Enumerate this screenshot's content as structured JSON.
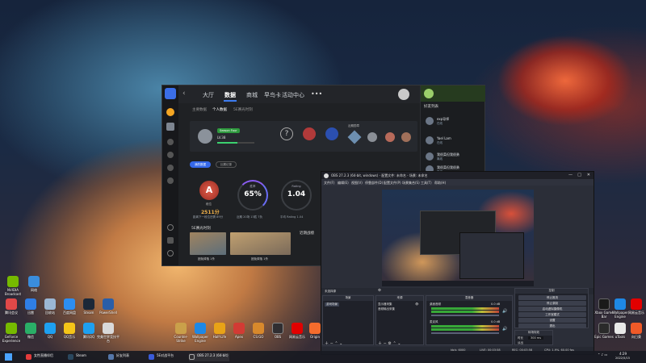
{
  "desktop": {
    "left_icons": [
      {
        "label": "NVIDIA Broadcast",
        "color": "#76b900"
      },
      {
        "label": "网络",
        "color": "#3a8ddc"
      },
      {
        "label": "腾讯会议",
        "color": "#e04848"
      },
      {
        "label": "迅雷",
        "color": "#2f7ee6"
      },
      {
        "label": "回收站",
        "color": "#9bb7d4"
      },
      {
        "label": "百度网盘",
        "color": "#2c8ef2"
      },
      {
        "label": "Steam",
        "color": "#1b2838"
      },
      {
        "label": "PowerShell",
        "color": "#2a5ea8"
      },
      {
        "label": "GeForce Experience",
        "color": "#76b900"
      },
      {
        "label": "微信",
        "color": "#2aae67"
      },
      {
        "label": "QQ",
        "color": "#1ea0f0"
      },
      {
        "label": "QQ音乐",
        "color": "#f5c518"
      },
      {
        "label": "腾讯QQ",
        "color": "#1ea0f0"
      },
      {
        "label": "完美世界竞技平台",
        "color": "#d9d9d9"
      }
    ],
    "dock_icons": [
      {
        "label": "Counter-Strike",
        "color": "#caa04a"
      },
      {
        "label": "Wallpaper Engine",
        "color": "#1e88e5"
      },
      {
        "label": "Half-Life",
        "color": "#e8a317"
      },
      {
        "label": "Apex",
        "color": "#d23b34"
      },
      {
        "label": "CS:GO",
        "color": "#d8892c"
      },
      {
        "label": "OBS",
        "color": "#302e31"
      },
      {
        "label": "网易云音乐",
        "color": "#e20000"
      },
      {
        "label": "Origin",
        "color": "#f56c2d"
      }
    ],
    "right_icons": [
      {
        "label": "Xbox Game Bar",
        "color": "#1a1a1a"
      },
      {
        "label": "Wallpaper Engine",
        "color": "#1e88e5"
      },
      {
        "label": "网易云音乐",
        "color": "#e20000"
      },
      {
        "label": "Epic Games",
        "color": "#2a2a2a"
      },
      {
        "label": "uTools",
        "color": "#e8e8e8"
      },
      {
        "label": "向日葵",
        "color": "#f05a28"
      }
    ]
  },
  "client": {
    "nav_tabs": [
      "大厅",
      "数据",
      "商城",
      "早鸟卡",
      "活动中心"
    ],
    "active_tab": "数据",
    "sub_tabs": [
      "主要数据",
      "个人数据",
      "5E赛光时刻"
    ],
    "profile": {
      "level_badge": "Season Four",
      "rank_text": "LV.38",
      "progress": 0.55
    },
    "medals_title": "近期勋章",
    "rank": {
      "letter": "A",
      "label": "段位",
      "score": "2511分",
      "score_sub": "距离下一段位还需 89分"
    },
    "rings": [
      {
        "label": "胜率",
        "value": "65%",
        "sub": "近期 20场 13胜 7负"
      },
      {
        "label": "Rating",
        "value": "1.04",
        "sub": "平均 Rating 1.04"
      }
    ],
    "highlights_title": "5E赛光时刻",
    "recent_title": "近期战绩",
    "clips": [
      {
        "caption": "团免掉落 1杀"
      },
      {
        "caption": "团免掉落 1杀"
      }
    ],
    "buttons": [
      "我的数据",
      "比赛记录"
    ],
    "friends_title": "好友列表",
    "friends": [
      {
        "name": "exp导师",
        "status": "在线"
      },
      {
        "name": "Yael Lam",
        "status": "在线"
      },
      {
        "name": "我很菜但我很勇",
        "status": "离线"
      },
      {
        "name": "我很菜但我很勇",
        "status": "离线"
      }
    ]
  },
  "obs": {
    "title": "OBS 27.2.3 (64-bit, windows) - 配置文件: 未命名 - 场景: 未命名",
    "menus": [
      "文件(F)",
      "编辑(E)",
      "视图(V)",
      "停靠部件(D)",
      "配置文件(P)",
      "场景集合(S)",
      "工具(T)",
      "帮助(H)"
    ],
    "no_source": "未选择源",
    "panels": {
      "scenes": {
        "title": "场景",
        "items": [
          "游戏场景"
        ]
      },
      "sources": {
        "title": "来源",
        "items": [
          "显示器采集",
          "音频输出采集"
        ]
      },
      "mixer": {
        "title": "混音器",
        "channels": [
          {
            "name": "桌面音频",
            "db": "0.0 dB"
          },
          {
            "name": "麦克风",
            "db": "0.0 dB"
          }
        ]
      },
      "transitions": {
        "title": "转场特效",
        "type": "淡出",
        "duration_label": "时长",
        "duration": "300 ms"
      },
      "controls": {
        "title": "控制",
        "buttons": [
          "停止推流",
          "停止录制",
          "启动虚拟摄像机",
          "工作室模式",
          "设置",
          "退出"
        ]
      }
    },
    "status": {
      "live": "LIVE: 00:03:58",
      "rec": "REC: 00:03:58",
      "cpu": "CPU: 1.9%, 60.00 fps",
      "kbps": "kb/s: 6000"
    }
  },
  "taskbar": {
    "items": [
      {
        "label": "女性直播伴侣",
        "color": "#e23b3b"
      },
      {
        "label": "Steam",
        "color": "#2a475e"
      },
      {
        "label": "好友列表",
        "color": "#5577aa"
      },
      {
        "label": "5E对战平台",
        "color": "#3a5bd9"
      },
      {
        "label": "OBS 27.2.3 (64-bit)",
        "color": "#302e31"
      }
    ],
    "time": "4:29",
    "date": "2022/5/15"
  }
}
